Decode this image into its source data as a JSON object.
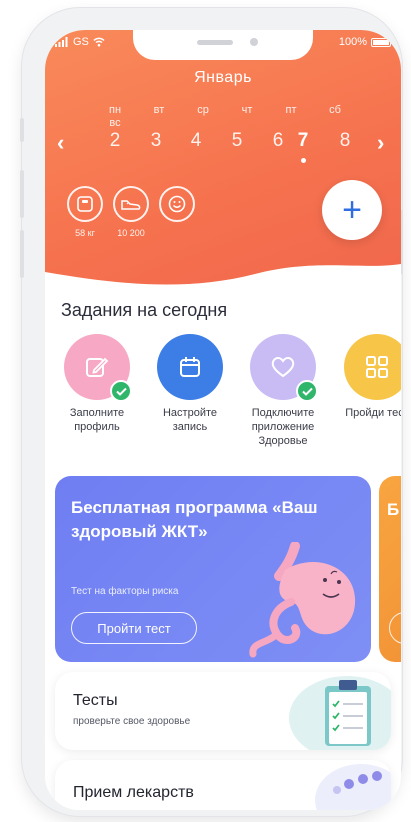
{
  "status_bar": {
    "carrier": "GS",
    "battery": "100%"
  },
  "calendar": {
    "month": "Январь",
    "weekdays": [
      "пн",
      "вт",
      "ср",
      "чт",
      "пт",
      "сб",
      "вс"
    ],
    "days": [
      "2",
      "3",
      "4",
      "5",
      "6",
      "7",
      "8"
    ],
    "selected_day": "7",
    "prev_label": "‹",
    "next_label": "›"
  },
  "stats": [
    {
      "icon": "scale-icon",
      "label": "58 кг"
    },
    {
      "icon": "sneaker-icon",
      "label": "10 200"
    },
    {
      "icon": "smile-icon",
      "label": ""
    }
  ],
  "add_button": {
    "label": "+"
  },
  "tasks": {
    "title": "Задания на сегодня",
    "items": [
      {
        "label": "Заполните профиль",
        "icon": "edit-icon",
        "color": "#f48fb1",
        "done": true
      },
      {
        "label": "Настройте запись",
        "icon": "calendar-icon",
        "color": "#3d7ee6",
        "done": false
      },
      {
        "label": "Подключите приложение Здоровье",
        "icon": "heart-icon",
        "color": "#c7b9f3",
        "done": true
      },
      {
        "label": "Пройди тест",
        "icon": "grid-icon",
        "color": "#f6c240",
        "done": false
      }
    ]
  },
  "promo": {
    "title": "Бесплатная программа «Ваш здоровый ЖКТ»",
    "subtitle": "Тест на факторы риска",
    "button": "Пройти тест",
    "next_title": "Б «"
  },
  "tests_card": {
    "title": "Тесты",
    "subtitle": "проверьте свое здоровье"
  },
  "meds_card": {
    "title": "Прием лекарств"
  },
  "colors": {
    "header": "#f6734f",
    "accent": "#2f6ee0",
    "promo": "#7384f3",
    "success": "#2fb66b"
  }
}
